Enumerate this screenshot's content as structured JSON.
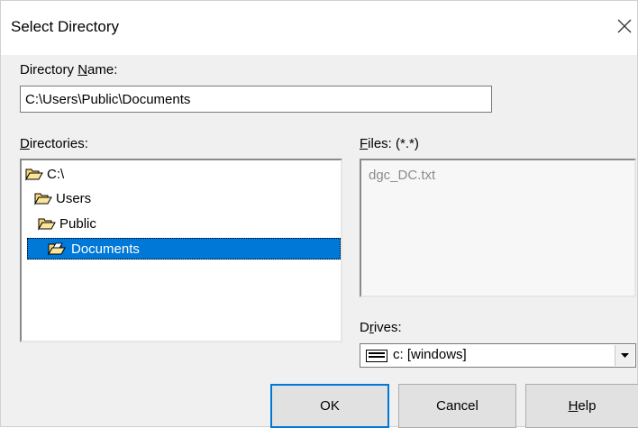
{
  "window": {
    "title": "Select Directory"
  },
  "directory_name": {
    "label_pre": "Directory ",
    "label_accel": "N",
    "label_post": "ame:",
    "value": "C:\\Users\\Public\\Documents"
  },
  "directories": {
    "label_accel": "D",
    "label_post": "irectories:",
    "items": [
      {
        "label": "C:\\"
      },
      {
        "label": "Users"
      },
      {
        "label": "Public"
      },
      {
        "label": "Documents",
        "selected": true
      }
    ]
  },
  "files": {
    "label_accel": "F",
    "label_post": "iles: (*.*)",
    "items": [
      {
        "label": "dgc_DC.txt"
      }
    ]
  },
  "drives": {
    "label_pre": "D",
    "label_accel": "r",
    "label_post": "ives:",
    "value": "c: [windows]",
    "icon": "drive-icon"
  },
  "buttons": {
    "ok": "OK",
    "cancel": "Cancel",
    "help_accel": "H",
    "help_post": "elp"
  },
  "colors": {
    "selection": "#0078d7",
    "folder": "#f7d774"
  }
}
